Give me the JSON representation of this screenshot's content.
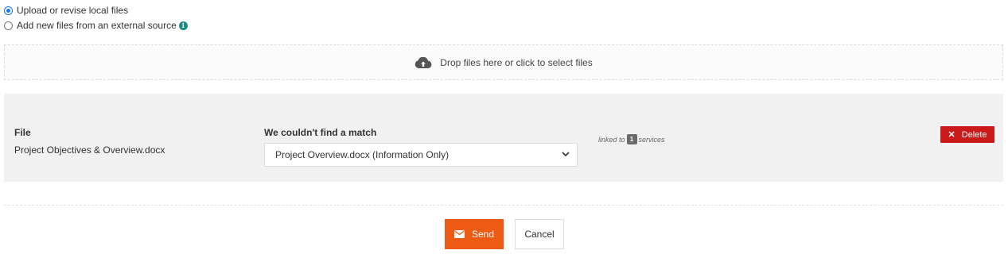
{
  "source_options": [
    {
      "label": "Upload or revise local files",
      "checked": true
    },
    {
      "label": "Add new files from an external source",
      "checked": false
    }
  ],
  "info_icon": {
    "glyph": "i",
    "name": "info-icon",
    "color": "#1c8a82"
  },
  "dropzone": {
    "text": "Drop files here or click to select files",
    "icon": "cloud-upload-icon"
  },
  "file_row": {
    "file_header": "File",
    "file_name": "Project Objectives & Overview.docx",
    "match_header": "We couldn't find a match",
    "match_selected": "Project Overview.docx (Information Only)",
    "linked_prefix": "linked to",
    "linked_count": "1",
    "linked_suffix": "services",
    "delete_label": "Delete"
  },
  "actions": {
    "send_label": "Send",
    "cancel_label": "Cancel"
  },
  "colors": {
    "accent": "#ec5a13",
    "danger": "#c91919",
    "radio": "#1a73e8"
  }
}
